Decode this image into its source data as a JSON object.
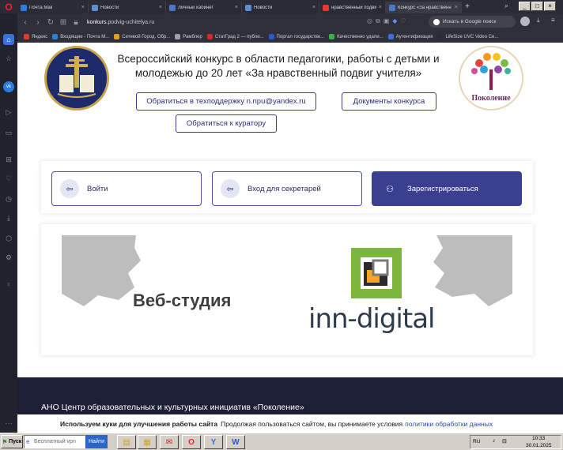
{
  "browser": {
    "tabs": [
      {
        "label": "Почта Mail",
        "color": "#2a7de1"
      },
      {
        "label": "Новости",
        "color": "#5a8fd8"
      },
      {
        "label": "Личный кабинет",
        "color": "#4a78c8"
      },
      {
        "label": "Новости",
        "color": "#5a8fd8"
      },
      {
        "label": "нравственный подвиг",
        "color": "#e23b2e"
      },
      {
        "label": "Конкурс «За нравственн",
        "color": "#4a78c8"
      }
    ],
    "url_host": "konkurs.",
    "url_rest": "podvig-uchitelya.ru",
    "search_placeholder": "Искать в Google поиск",
    "bookmarks": [
      {
        "label": "Яндекс",
        "color": "#e23b2e"
      },
      {
        "label": "Входящие - Почта М...",
        "color": "#2a7de1"
      },
      {
        "label": "Сетевой Город. Обр...",
        "color": "#d9a21b"
      },
      {
        "label": "Рамблер",
        "color": "#9aa0ad"
      },
      {
        "label": "СтатГрад 2 — публи...",
        "color": "#d9262b"
      },
      {
        "label": "Портал государстве...",
        "color": "#2b59c3"
      },
      {
        "label": "Качественно удали...",
        "color": "#3fae49"
      },
      {
        "label": "Аутентификация",
        "color": "#3a6fd8"
      },
      {
        "label": "LifeSize UVC Video Ce...",
        "color": "#2b2b35"
      }
    ]
  },
  "header": {
    "title": "Всероссийский конкурс в области педагогики, работы с детьми и молодежью до 20 лет «За нравственный подвиг учителя»",
    "support_button": "Обратиться в техподдержку n.npu@yandex.ru",
    "documents_button": "Документы конкурса",
    "curator_button": "Обратиться к куратору",
    "right_logo_text": "Поколение"
  },
  "auth": {
    "login_label": "Войти",
    "secretary_label": "Вход для секретарей",
    "register_label": "Зарегистрироваться"
  },
  "banner": {
    "studio_text": "Веб-студия",
    "brand_text": "inn-digital"
  },
  "footer": {
    "org_name": "АНО Центр образовательных и культурных инициатив «Поколение»"
  },
  "cookie": {
    "bold": "Используем куки для улучшения работы сайта",
    "text": "Продолжая пользоваться сайтом, вы принимаете условия",
    "link": "политики обработки данных"
  },
  "taskbar": {
    "start_label": "Пуск",
    "vpn_placeholder": "Бесплатный vpn",
    "find_label": "Найти",
    "lang": "RU",
    "time": "10:33",
    "date": "30.01.2025"
  }
}
